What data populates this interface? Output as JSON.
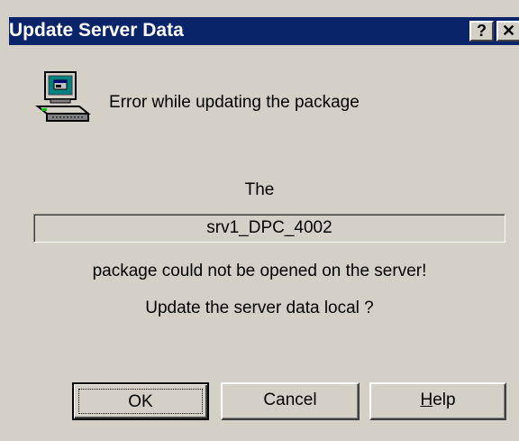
{
  "window": {
    "title": "Update Server Data",
    "help_glyph": "?",
    "close_glyph": "✕"
  },
  "icon": {
    "name": "computer-icon"
  },
  "messages": {
    "error": "Error while updating the package",
    "the": "The",
    "package_name": "srv1_DPC_4002",
    "not_opened": "package could not be opened on the server!",
    "question": "Update the server data local ?"
  },
  "buttons": {
    "ok": "OK",
    "cancel": "Cancel",
    "help_first": "H",
    "help_rest": "elp"
  },
  "colors": {
    "titlebar": "#0a246a",
    "face": "#d4d0c8"
  }
}
